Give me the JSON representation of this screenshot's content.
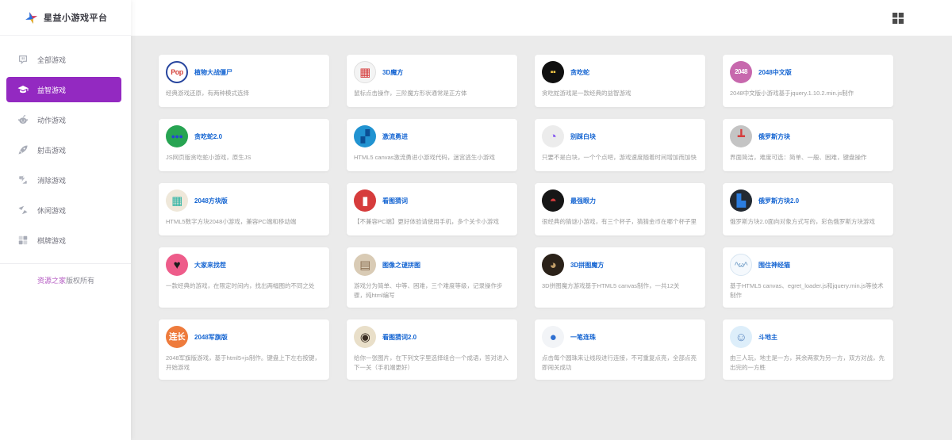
{
  "app": {
    "title": "星益小游戏平台"
  },
  "colors": {
    "accent": "#9329c1",
    "link": "#1565d2",
    "page_bg": "#ebebeb",
    "desc_text": "#9b9b9b",
    "footer_brand": "#b45ac2"
  },
  "topbar": {
    "apps_icon": "apps-grid-icon"
  },
  "sidebar": {
    "items": [
      {
        "label": "全部游戏",
        "icon": "chat-bubble-icon",
        "active": false
      },
      {
        "label": "益智游戏",
        "icon": "graduation-cap-icon",
        "active": true
      },
      {
        "label": "动作游戏",
        "icon": "robot-head-icon",
        "active": false
      },
      {
        "label": "射击游戏",
        "icon": "rocket-icon",
        "active": false
      },
      {
        "label": "消除游戏",
        "icon": "swap-arrows-icon",
        "active": false
      },
      {
        "label": "休闲游戏",
        "icon": "paper-planes-icon",
        "active": false
      },
      {
        "label": "棋牌游戏",
        "icon": "board-grid-icon",
        "active": false
      }
    ],
    "footer": {
      "brand": "资源之家",
      "suffix": "版权所有"
    }
  },
  "games": [
    {
      "title": "植物大战僵尸",
      "desc": "经典游戏还原，有两种模式选择",
      "icon": {
        "name": "popcap-logo-icon",
        "glyph": "Pop",
        "bg": "#ffffff",
        "fg": "#d6453d",
        "border": "2px solid #27459e"
      }
    },
    {
      "title": "3D魔方",
      "desc": "鼠标点击操作，三阶魔方形状通常是正方体",
      "icon": {
        "name": "rubiks-cube-icon",
        "glyph": "▦",
        "bg": "#f4f4f4",
        "fg": "#d63c3c",
        "border": "1px solid #e0e0e0"
      }
    },
    {
      "title": "贪吃蛇",
      "desc": "贪吃蛇游戏是一款经典的益智游戏",
      "icon": {
        "name": "snake-icon",
        "glyph": "▪▪",
        "bg": "#101010",
        "fg": "#f7c948"
      }
    },
    {
      "title": "2048中文版",
      "desc": "2048中文版小游戏基于jquery.1.10.2.min.js制作",
      "icon": {
        "name": "number-2048-icon",
        "glyph": "2048",
        "bg": "#c768ad",
        "fg": "#ffffff"
      }
    },
    {
      "title": "贪吃蛇2.0",
      "desc": "JS网页版贪吃蛇小游戏，原生JS",
      "icon": {
        "name": "snake-2-icon",
        "glyph": "●●●",
        "bg": "#27a452",
        "fg": "#2743d6"
      }
    },
    {
      "title": "激流勇进",
      "desc": "HTML5 canvas激流勇进小游戏代码，迷宫逃生小游戏",
      "icon": {
        "name": "rapids-stairs-icon",
        "glyph": "▞",
        "bg": "#2193d1",
        "fg": "#0b4f94"
      }
    },
    {
      "title": "别踩白块",
      "desc": "只要不是白块，一个个点吧，游戏速度随着时间增加而加快",
      "icon": {
        "name": "quadrant-tile-icon",
        "glyph": "◔",
        "bg": "#ececec",
        "fg": "#8256f0"
      }
    },
    {
      "title": "俄罗斯方块",
      "desc": "界面简洁，难度可选：简单、一般、困难，键盘操作",
      "icon": {
        "name": "tetris-icon",
        "glyph": "┻",
        "bg": "#c4c4c4",
        "fg": "#d63c3c"
      }
    },
    {
      "title": "2048方块版",
      "desc": "HTML5数字方块2048小游戏，兼容PC端和移动端",
      "icon": {
        "name": "blocks-2048-icon",
        "glyph": "▦",
        "bg": "#efe8da",
        "fg": "#2bb3a3"
      }
    },
    {
      "title": "看图猜词",
      "desc": "【不兼容PC端】更好体验请使用手机，多个关卡小游戏",
      "icon": {
        "name": "cola-bottle-icon",
        "glyph": "▮",
        "bg": "#d63c3c",
        "fg": "#ffffff"
      }
    },
    {
      "title": "最强眼力",
      "desc": "很经典的猜谜小游戏，有三个杯子，猜猜金币在哪个杯子里",
      "icon": {
        "name": "ball-coin-icon",
        "glyph": "◓",
        "bg": "#161616",
        "fg": "#d63c3c"
      }
    },
    {
      "title": "俄罗斯方块2.0",
      "desc": "俄罗斯方块2.0面向对象方式写的，彩色俄罗斯方块游戏",
      "icon": {
        "name": "tetris-2-icon",
        "glyph": "▙",
        "bg": "#232a33",
        "fg": "#2b7de0"
      }
    },
    {
      "title": "大家来找茬",
      "desc": "一款经典的游戏，在限定时间内，找出两幅图的不同之处",
      "icon": {
        "name": "heart-cherries-icon",
        "glyph": "♥",
        "bg": "#ee5c8a",
        "fg": "#1c1c1c"
      }
    },
    {
      "title": "图像之谜拼图",
      "desc": "游戏分为简单、中等、困难，三个难度等级，记录操作步骤，纯html编写",
      "icon": {
        "name": "picture-puzzle-icon",
        "glyph": "▤",
        "bg": "#d9cbb5",
        "fg": "#8a6f52"
      }
    },
    {
      "title": "3D拼图魔方",
      "desc": "3D拼图魔方游戏基于HTML5 canvas制作，一共12关",
      "icon": {
        "name": "pie-cube-icon",
        "glyph": "◕",
        "bg": "#2b2219",
        "fg": "#c4a06a"
      }
    },
    {
      "title": "围住神经猫",
      "desc": "基于HTML5 canvas、egret_loader.js和jquery.min.js等技术制作",
      "icon": {
        "name": "cat-face-icon",
        "glyph": "^ω^",
        "bg": "#f5f9fd",
        "fg": "#7ea6cc",
        "border": "1px solid #d8e6f2"
      }
    },
    {
      "title": "2048军旗版",
      "desc": "2048军旗版游戏，基于html5+js制作。键盘上下左右按键，开始游戏",
      "icon": {
        "name": "lianzhang-badge-icon",
        "glyph": "连长",
        "bg": "#ee7b3c",
        "fg": "#ffffff"
      }
    },
    {
      "title": "看图猜词2.0",
      "desc": "给你一张图片，在下列文字里选择组合一个成语，答对进入下一关（手机端更好）",
      "icon": {
        "name": "eye-icon",
        "glyph": "◉",
        "bg": "#e9dfc9",
        "fg": "#3a2d22"
      }
    },
    {
      "title": "一笔连珠",
      "desc": "点击每个圆珠来让线段进行连接，不可重复点亮，全部点亮即闯关成功",
      "icon": {
        "name": "marble-icon",
        "glyph": "●",
        "bg": "#f2f4f7",
        "fg": "#2f6fd1"
      }
    },
    {
      "title": "斗地主",
      "desc": "由三人玩，地主是一方，其余两家为另一方，双方对战，先出完的一方胜",
      "icon": {
        "name": "landlord-boy-icon",
        "glyph": "☺",
        "bg": "#ddeefa",
        "fg": "#5a86c0"
      }
    }
  ]
}
